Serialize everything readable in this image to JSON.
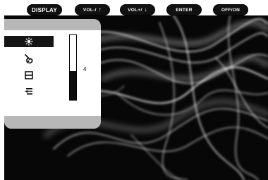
{
  "buttons": {
    "display": "DISPLAY",
    "vol_down": "VOL-/",
    "vol_up": "VOL+/",
    "enter": "ENTER",
    "off_on": "OFF/ON"
  },
  "osd": {
    "menu_items": [
      {
        "icon": "brightness-sun-icon",
        "selected": true
      },
      {
        "icon": "color-palette-icon",
        "selected": false
      },
      {
        "icon": "window-frame-icon",
        "selected": false
      },
      {
        "icon": "video-input-icon",
        "selected": false
      }
    ],
    "level": {
      "value": "4",
      "fill_fraction": 0.45
    }
  },
  "colors": {
    "osd_frame": "#b7b7b7",
    "osd_body": "#ffffff",
    "selection": "#151515",
    "screen_bg": "#070707"
  }
}
